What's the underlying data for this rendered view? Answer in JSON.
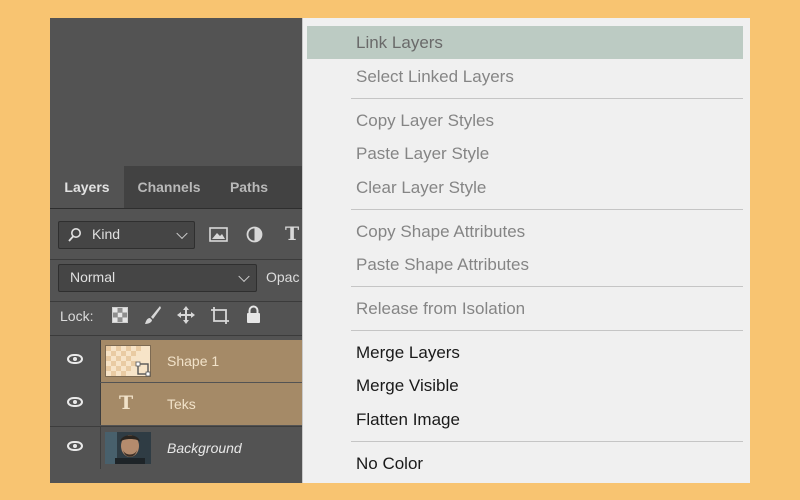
{
  "panel": {
    "tabs": [
      {
        "label": "Layers",
        "active": true
      },
      {
        "label": "Channels",
        "active": false
      },
      {
        "label": "Paths",
        "active": false
      }
    ],
    "filter": {
      "icon": "search-icon",
      "label": "Kind",
      "type_icon_glyph": "T"
    },
    "blend_mode": {
      "value": "Normal",
      "opacity_label": "Opac"
    },
    "lock": {
      "label": "Lock:"
    },
    "layers": [
      {
        "name": "Shape 1",
        "selected": true,
        "thumb": "shape-thumbnail"
      },
      {
        "name": "Teks",
        "selected": true,
        "thumb": "text-icon",
        "thumb_glyph": "T"
      },
      {
        "name": "Background",
        "selected": false,
        "thumb": "photo-thumbnail"
      }
    ]
  },
  "menu": {
    "items": [
      {
        "label": "Link Layers",
        "enabled": false,
        "highlighted": true
      },
      {
        "label": "Select Linked Layers",
        "enabled": false
      },
      {
        "label": "Copy Layer Styles",
        "enabled": false
      },
      {
        "label": "Paste Layer Style",
        "enabled": false
      },
      {
        "label": "Clear Layer Style",
        "enabled": false
      },
      {
        "label": "Copy Shape Attributes",
        "enabled": false
      },
      {
        "label": "Paste Shape Attributes",
        "enabled": false
      },
      {
        "label": "Release from Isolation",
        "enabled": false
      },
      {
        "label": "Merge Layers",
        "enabled": true
      },
      {
        "label": "Merge Visible",
        "enabled": true
      },
      {
        "label": "Flatten Image",
        "enabled": true
      },
      {
        "label": "No Color",
        "enabled": true
      }
    ]
  },
  "colors": {
    "background": "#f8c471",
    "panel": "#535353",
    "selected_layer": "#a58a67",
    "menu": "#f0f0f0",
    "menu_highlight": "#bccbc3"
  }
}
